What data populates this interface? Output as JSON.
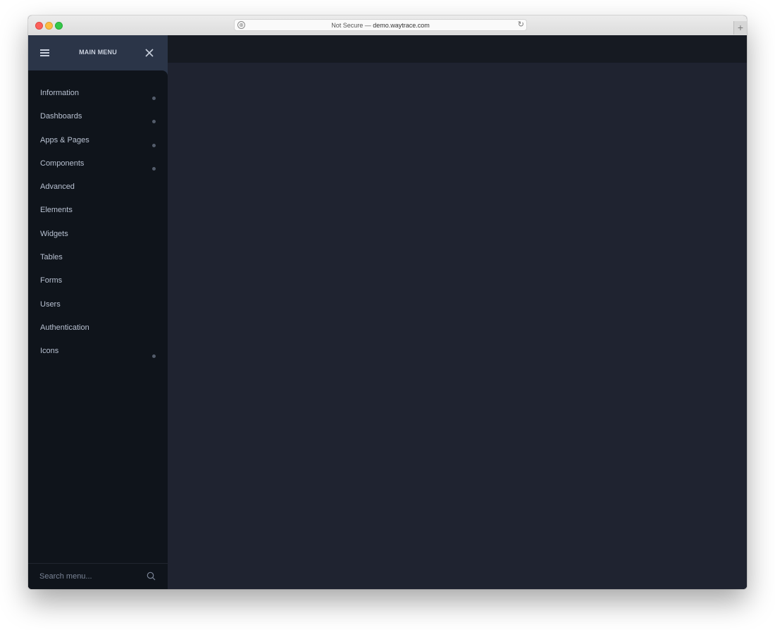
{
  "browser": {
    "url_prefix": "Not Secure —",
    "url_host": "demo.waytrace.com",
    "site_icon": "globe-icon",
    "reload_icon": "reload-icon",
    "new_tab_glyph": "+"
  },
  "sidebar": {
    "title": "MAIN MENU",
    "menu_icon": "hamburger-icon",
    "close_icon": "close-icon",
    "items": [
      {
        "label": "Information",
        "has_submenu": true
      },
      {
        "label": "Dashboards",
        "has_submenu": true
      },
      {
        "label": "Apps & Pages",
        "has_submenu": true
      },
      {
        "label": "Components",
        "has_submenu": true
      },
      {
        "label": "Advanced",
        "has_submenu": false
      },
      {
        "label": "Elements",
        "has_submenu": false
      },
      {
        "label": "Widgets",
        "has_submenu": false
      },
      {
        "label": "Tables",
        "has_submenu": false
      },
      {
        "label": "Forms",
        "has_submenu": false
      },
      {
        "label": "Users",
        "has_submenu": false
      },
      {
        "label": "Authentication",
        "has_submenu": false
      },
      {
        "label": "Icons",
        "has_submenu": true
      }
    ],
    "search": {
      "placeholder": "Search menu...",
      "value": "",
      "icon": "search-icon"
    }
  },
  "colors": {
    "sidebar_header": "#2b3548",
    "sidebar_body": "#0f141b",
    "topbar": "#161a22",
    "content": "#1f2330",
    "menu_text": "#b8c1d1"
  }
}
